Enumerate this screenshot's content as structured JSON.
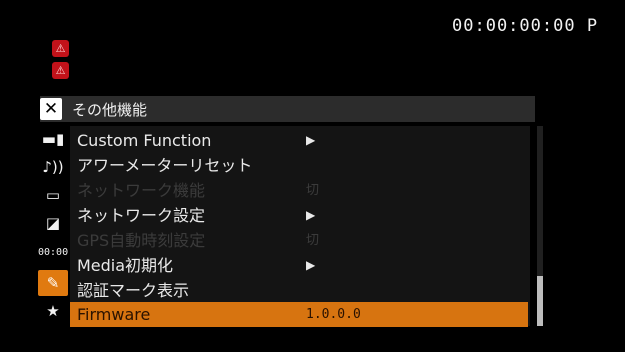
{
  "timecode": "00:00:00:00 P",
  "menu": {
    "title": "その他機能",
    "close_glyph": "✕"
  },
  "sidebar": {
    "tabs": [
      {
        "icon": "camera-icon",
        "glyph": "▬▮"
      },
      {
        "icon": "audio-icon",
        "glyph": "♪))"
      },
      {
        "icon": "recording-media-icon",
        "glyph": "▭"
      },
      {
        "icon": "display-icon",
        "glyph": "◪"
      },
      {
        "icon": "timecode-icon",
        "glyph": "00:00"
      },
      {
        "icon": "system-setup-icon",
        "glyph": "✎",
        "active": true
      },
      {
        "icon": "my-menu-star-icon",
        "glyph": "★"
      }
    ]
  },
  "items": [
    {
      "label": "Custom Function",
      "value": "▶",
      "state": "normal"
    },
    {
      "label": "アワーメーターリセット",
      "value": "",
      "state": "normal"
    },
    {
      "label": "ネットワーク機能",
      "value": "切",
      "state": "disabled"
    },
    {
      "label": "ネットワーク設定",
      "value": "▶",
      "state": "normal"
    },
    {
      "label": "GPS自動時刻設定",
      "value": "切",
      "state": "disabled"
    },
    {
      "label": "Media初期化",
      "value": "▶",
      "state": "normal"
    },
    {
      "label": "認証マーク表示",
      "value": "",
      "state": "normal"
    },
    {
      "label": "Firmware",
      "value": "1.0.0.0",
      "state": "selected"
    }
  ],
  "colors": {
    "accent": "#d77410",
    "disabled_text": "#3b3b3b",
    "warning_red": "#c2121a"
  }
}
